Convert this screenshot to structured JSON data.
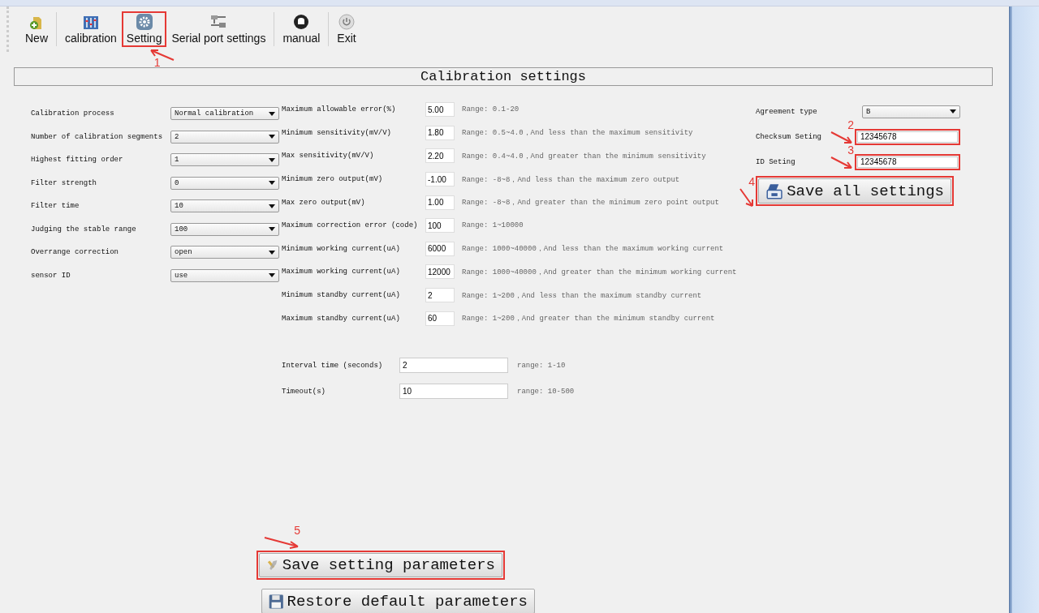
{
  "toolbar": [
    {
      "label": "New",
      "kind": "new"
    },
    {
      "label": "calibration",
      "kind": "calibration"
    },
    {
      "label": "Setting",
      "kind": "setting",
      "callout": "1"
    },
    {
      "label": "Serial port settings",
      "kind": "serial"
    },
    {
      "label": "manual",
      "kind": "manual"
    },
    {
      "label": "Exit",
      "kind": "exit"
    }
  ],
  "panel_title": "Calibration settings",
  "selects": [
    {
      "label": "Calibration process",
      "value": "Normal calibration"
    },
    {
      "label": "Number of calibration segments",
      "value": "2"
    },
    {
      "label": "Highest fitting order",
      "value": "1"
    },
    {
      "label": "Filter strength",
      "value": "0"
    },
    {
      "label": "Filter time",
      "value": "10"
    },
    {
      "label": "Judging the stable range",
      "value": "100"
    },
    {
      "label": "Overrange correction",
      "value": "open"
    },
    {
      "label": "sensor ID",
      "value": "use"
    }
  ],
  "parameters": [
    {
      "label": "Maximum allowable error(%)",
      "value": "5.00",
      "range": "Range: 0.1-20"
    },
    {
      "label": "Minimum sensitivity(mV/V)",
      "value": "1.80",
      "range": "Range: 0.5~4.0，And less than the maximum sensitivity"
    },
    {
      "label": "Max sensitivity(mV/V)",
      "value": "2.20",
      "range": "Range: 0.4~4.0，And greater than the minimum sensitivity"
    },
    {
      "label": "Minimum zero output(mV)",
      "value": "-1.00",
      "range": "Range: -8~8，And less than the maximum zero output"
    },
    {
      "label": "Max  zero output(mV)",
      "value": "1.00",
      "range": "Range: -8~8，And greater than the minimum zero point output"
    },
    {
      "label": "Maximum correction error (code)",
      "value": "100",
      "range": "Range: 1~10000"
    },
    {
      "label": "Minimum working current(uA)",
      "value": "6000",
      "range": "Range: 1000~40000，And less than the maximum working current"
    },
    {
      "label": "Maximum working current(uA)",
      "value": "12000",
      "range": "Range: 1000~40000，And greater than the minimum working current"
    },
    {
      "label": "Minimum standby current(uA)",
      "value": "2",
      "range": "Range: 1~200，And less than the maximum standby current"
    },
    {
      "label": "Maximum standby current(uA)",
      "value": "60",
      "range": "Range: 1~200，And greater than the minimum standby current"
    }
  ],
  "timing": [
    {
      "label": "Interval time (seconds)",
      "value": "2",
      "range": "range: 1-10"
    },
    {
      "label": "Timeout(s)",
      "value": "10",
      "range": "range: 10-500"
    }
  ],
  "agreement": {
    "label": "Agreement type",
    "value": "B"
  },
  "id_fields": [
    {
      "label": "Checksum Seting",
      "value": "12345678",
      "callout": "2"
    },
    {
      "label": "ID Seting",
      "value": "12345678",
      "callout": "3"
    }
  ],
  "save_all": {
    "label": "Save all settings",
    "callout": "4"
  },
  "bottom_buttons": [
    {
      "label": "Save setting parameters",
      "kind": "save",
      "callout": "5"
    },
    {
      "label": "Restore default parameters",
      "kind": "restore"
    }
  ]
}
